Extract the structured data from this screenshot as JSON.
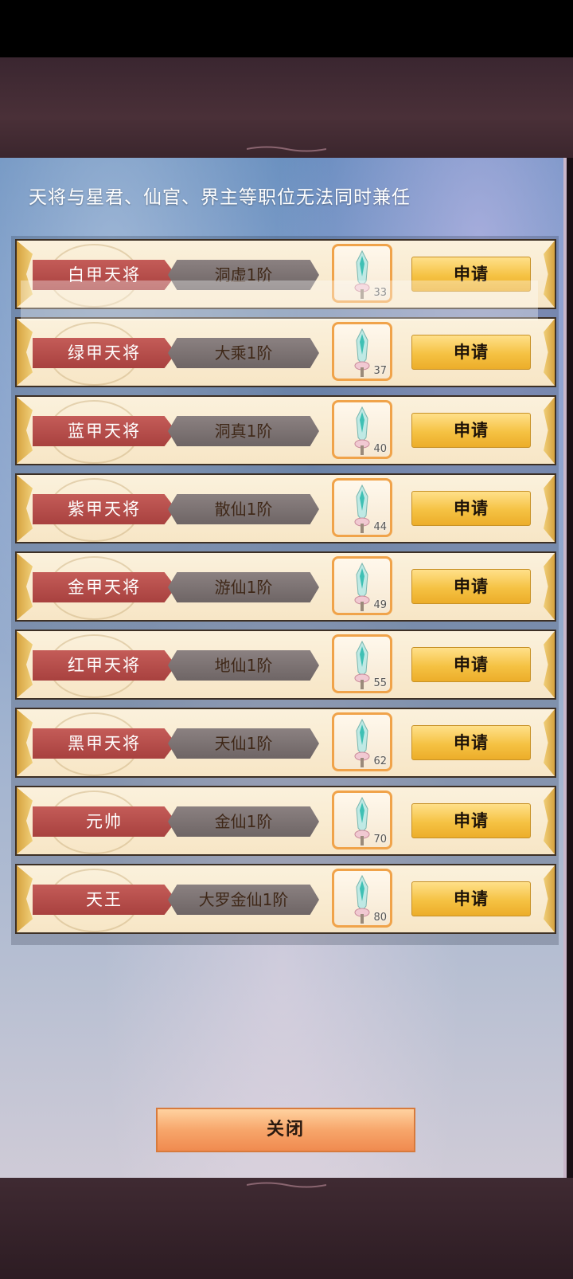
{
  "notice": "天将与星君、仙官、界主等职位无法同时兼任",
  "positions": [
    {
      "title": "白甲天将",
      "requirement": "洞虚1阶",
      "item_count": "33",
      "apply_label": "申请"
    },
    {
      "title": "绿甲天将",
      "requirement": "大乘1阶",
      "item_count": "37",
      "apply_label": "申请"
    },
    {
      "title": "蓝甲天将",
      "requirement": "洞真1阶",
      "item_count": "40",
      "apply_label": "申请"
    },
    {
      "title": "紫甲天将",
      "requirement": "散仙1阶",
      "item_count": "44",
      "apply_label": "申请"
    },
    {
      "title": "金甲天将",
      "requirement": "游仙1阶",
      "item_count": "49",
      "apply_label": "申请"
    },
    {
      "title": "红甲天将",
      "requirement": "地仙1阶",
      "item_count": "55",
      "apply_label": "申请"
    },
    {
      "title": "黑甲天将",
      "requirement": "天仙1阶",
      "item_count": "62",
      "apply_label": "申请"
    },
    {
      "title": "元帅",
      "requirement": "金仙1阶",
      "item_count": "70",
      "apply_label": "申请"
    },
    {
      "title": "天王",
      "requirement": "大罗金仙1阶",
      "item_count": "80",
      "apply_label": "申请"
    }
  ],
  "close_label": "关闭",
  "colors": {
    "ribbon": "#b44c4a",
    "apply_button": "#f5c243",
    "close_button": "#f7a66b",
    "slot_border": "#f0a34a"
  }
}
